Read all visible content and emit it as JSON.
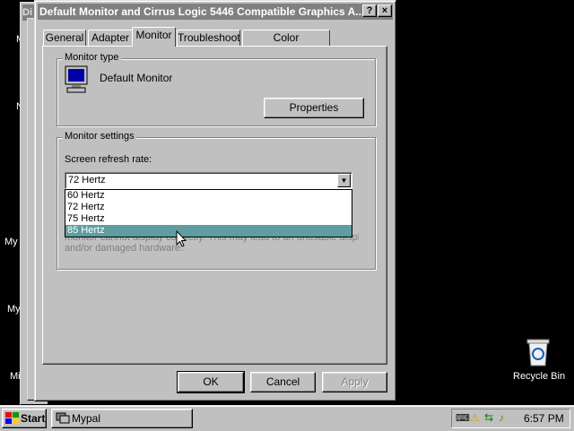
{
  "dialog": {
    "title": "Default Monitor and Cirrus Logic 5446 Compatible Graphics A...",
    "help_btn": "?",
    "close_btn": "×",
    "tabs": [
      "General",
      "Adapter",
      "Monitor",
      "Troubleshoot",
      "Color Management"
    ],
    "active_tab": "Monitor",
    "monitor_type": {
      "group_label": "Monitor type",
      "monitor_name": "Default Monitor",
      "properties_btn": "Properties"
    },
    "monitor_settings": {
      "group_label": "Monitor settings",
      "refresh_label": "Screen refresh rate:",
      "selected_value": "72 Hertz",
      "options": [
        "60 Hertz",
        "72 Hertz",
        "75 Hertz",
        "85 Hertz"
      ],
      "highlighted_option": "85 Hertz",
      "warning_line1": "monitor cannot display correctly. This may lead to an unusable display",
      "warning_line2": "and/or damaged hardware."
    },
    "buttons": {
      "ok": "OK",
      "cancel": "Cancel",
      "apply": "Apply"
    }
  },
  "desktop": {
    "icons": [
      "My",
      "My",
      "Recycle Bin"
    ],
    "side_letters": [
      "M",
      "N",
      "Mi"
    ],
    "bg_title_prefix": "Di"
  },
  "taskbar": {
    "start_label": "Start",
    "task_label": "Mypal",
    "clock": "6:57 PM"
  },
  "colors": {
    "desktop": "#000000",
    "window": "#c0c0c0",
    "title_inactive": "#808080",
    "highlight": "#5f9ea0"
  }
}
